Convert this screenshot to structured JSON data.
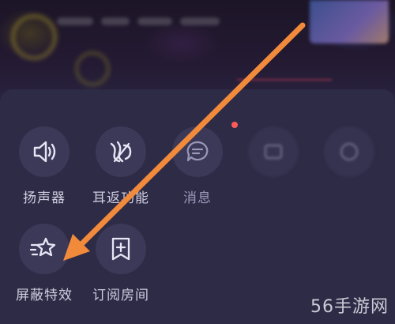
{
  "panel": {
    "row1": [
      {
        "label": "扬声器",
        "icon": "speaker-icon"
      },
      {
        "label": "耳返功能",
        "icon": "ear-return-icon"
      },
      {
        "label": "消息",
        "icon": "message-icon",
        "badge": true
      },
      {
        "label": "",
        "icon": "blurred-icon"
      },
      {
        "label": "",
        "icon": "blurred-icon"
      }
    ],
    "row2": [
      {
        "label": "屏蔽特效",
        "icon": "block-effects-icon"
      },
      {
        "label": "订阅房间",
        "icon": "subscribe-room-icon"
      }
    ]
  },
  "annotation": {
    "arrow_color": "#f28a3c"
  },
  "watermark": "56手游网",
  "colors": {
    "panel_bg": "#2d2b45",
    "tile_bg": "#3b3957",
    "label": "#cfcde0",
    "badge": "#ff5a5a"
  }
}
